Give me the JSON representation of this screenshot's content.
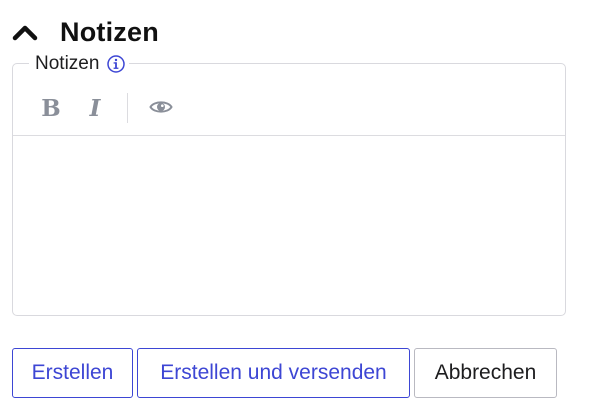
{
  "section": {
    "title": "Notizen",
    "toggle_icon": "chevron-up-icon"
  },
  "notes_field": {
    "label": "Notizen",
    "info_icon": "info-icon",
    "value": "",
    "toolbar": {
      "bold_label": "B",
      "italic_label": "I",
      "preview_icon": "eye-icon"
    }
  },
  "actions": {
    "create_label": "Erstellen",
    "create_send_label": "Erstellen und versenden",
    "cancel_label": "Abbrechen"
  },
  "colors": {
    "accent": "#3d46d4",
    "border": "#d9d9de",
    "toolbar_icon": "#8a8f99",
    "text": "#111111"
  }
}
